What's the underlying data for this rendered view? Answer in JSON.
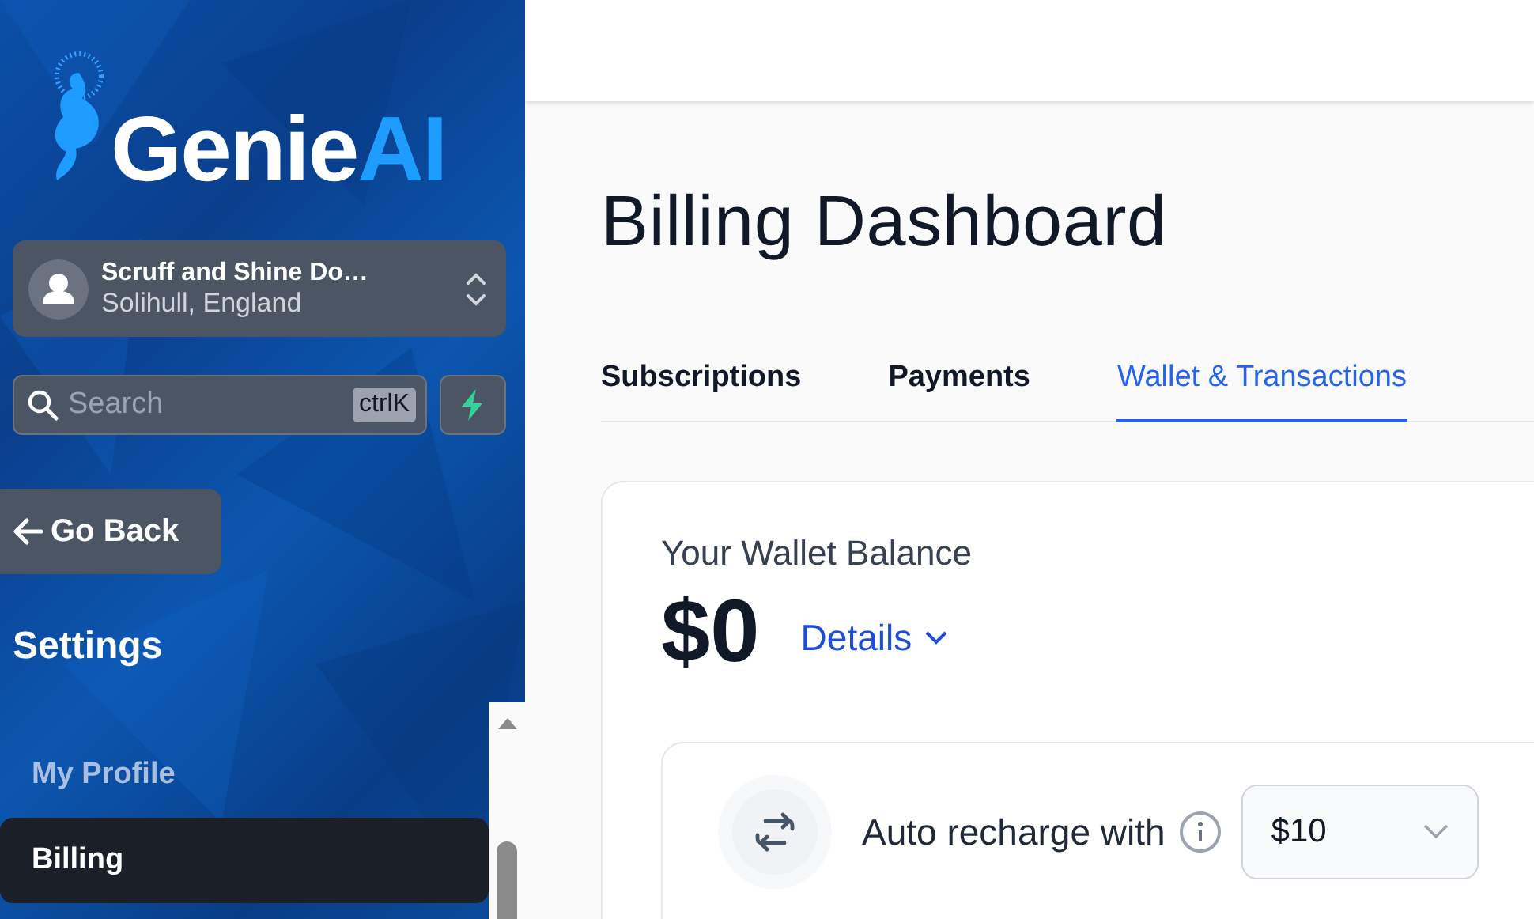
{
  "sidebar": {
    "logo": {
      "word": "Genie",
      "accent": "AI"
    },
    "account": {
      "name": "Scruff and Shine Do…",
      "location": "Solihull, England"
    },
    "search": {
      "placeholder": "Search",
      "shortcut": "ctrlK"
    },
    "back_button": "Go Back",
    "section_title": "Settings",
    "items": [
      {
        "label": "My Profile",
        "selected": false
      },
      {
        "label": "Billing",
        "selected": true
      }
    ]
  },
  "page": {
    "title": "Billing Dashboard",
    "tabs": [
      {
        "label": "Subscriptions",
        "selected": false
      },
      {
        "label": "Payments",
        "selected": false
      },
      {
        "label": "Wallet & Transactions",
        "selected": true
      }
    ],
    "wallet": {
      "heading": "Your Wallet Balance",
      "balance": "$0",
      "details_link": "Details",
      "auto_recharge": {
        "label": "Auto recharge with",
        "amount": "$10"
      }
    }
  }
}
